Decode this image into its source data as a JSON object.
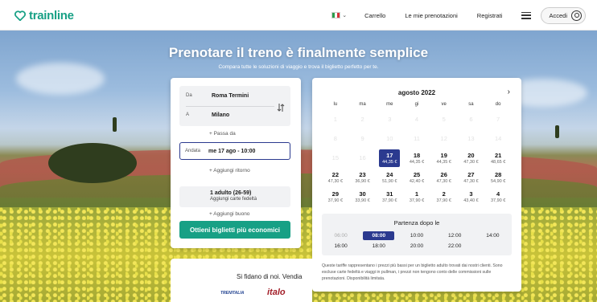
{
  "header": {
    "logo_text": "trainline",
    "flag_chevron": "⌄",
    "nav_items": [
      "Carrello",
      "Le mie prenotazioni",
      "Registrati"
    ],
    "login_label": "Accedi"
  },
  "hero": {
    "title": "Prenotare il treno è finalmente semplice",
    "subtitle": "Compara tutte le soluzioni di viaggio e trova il biglietto perfetto per te."
  },
  "search": {
    "from_label": "Da",
    "from_value": "Roma Termini",
    "to_label": "A",
    "to_value": "Milano",
    "via_link": "+ Passa da",
    "outbound_label": "Andata",
    "outbound_value": "me 17 ago - 10:00",
    "return_link": "+ Aggiungi ritorno",
    "passengers_value": "1 adulto (26-59)",
    "passengers_sub": "Aggiungi carte fedeltà",
    "voucher_link": "+ Aggiungi buono",
    "cta_label": "Ottieni biglietti più economici"
  },
  "calendar": {
    "month": "agosto 2022",
    "next_icon": "›",
    "weekdays": [
      "lu",
      "ma",
      "me",
      "gi",
      "ve",
      "sa",
      "do"
    ],
    "weeks": [
      [
        {
          "n": "1",
          "p": "",
          "past": true
        },
        {
          "n": "2",
          "p": "",
          "past": true
        },
        {
          "n": "3",
          "p": "",
          "past": true
        },
        {
          "n": "4",
          "p": "",
          "past": true
        },
        {
          "n": "5",
          "p": "",
          "past": true
        },
        {
          "n": "6",
          "p": "",
          "past": true
        },
        {
          "n": "7",
          "p": "",
          "past": true
        }
      ],
      [
        {
          "n": "8",
          "p": "",
          "past": true
        },
        {
          "n": "9",
          "p": "",
          "past": true
        },
        {
          "n": "10",
          "p": "",
          "past": true
        },
        {
          "n": "11",
          "p": "",
          "past": true
        },
        {
          "n": "12",
          "p": "",
          "past": true
        },
        {
          "n": "13",
          "p": "",
          "past": true
        },
        {
          "n": "14",
          "p": "",
          "past": true
        }
      ],
      [
        {
          "n": "15",
          "p": "",
          "past": true
        },
        {
          "n": "16",
          "p": "",
          "past": true
        },
        {
          "n": "17",
          "p": "44,35 €",
          "selected": true
        },
        {
          "n": "18",
          "p": "44,35 €"
        },
        {
          "n": "19",
          "p": "44,35 €"
        },
        {
          "n": "20",
          "p": "47,30 €"
        },
        {
          "n": "21",
          "p": "48,65 €"
        }
      ],
      [
        {
          "n": "22",
          "p": "47,30 €"
        },
        {
          "n": "23",
          "p": "36,90 €"
        },
        {
          "n": "24",
          "p": "51,90 €"
        },
        {
          "n": "25",
          "p": "42,40 €"
        },
        {
          "n": "26",
          "p": "47,30 €"
        },
        {
          "n": "27",
          "p": "47,30 €"
        },
        {
          "n": "28",
          "p": "54,90 €"
        }
      ],
      [
        {
          "n": "29",
          "p": "37,90 €"
        },
        {
          "n": "30",
          "p": "33,90 €"
        },
        {
          "n": "31",
          "p": "37,90 €"
        },
        {
          "n": "1",
          "p": "37,90 €"
        },
        {
          "n": "2",
          "p": "37,90 €"
        },
        {
          "n": "3",
          "p": "43,40 €"
        },
        {
          "n": "4",
          "p": "37,90 €"
        }
      ]
    ],
    "departure_title": "Partenza dopo le",
    "times_row1": [
      {
        "t": "06:00",
        "dim": true
      },
      {
        "t": "08:00",
        "selected": true
      },
      {
        "t": "10:00"
      },
      {
        "t": "12:00"
      },
      {
        "t": "14:00"
      }
    ],
    "times_row2": [
      {
        "t": "16:00"
      },
      {
        "t": "18:00"
      },
      {
        "t": "20:00"
      },
      {
        "t": "22:00"
      }
    ],
    "note": "Queste tariffe rappresentano i prezzi più bassi per un biglietto adulto trovati dai nostri clienti. Sono escluse carte fedeltà e viaggi in pullman, i prezzi non tengono conto delle commissioni sulle prenotazioni. Disponibilità limitata."
  },
  "trust": {
    "title": "Si fidano di noi. Vendia",
    "partners": [
      "TRENITALIA",
      "italo"
    ]
  },
  "colors": {
    "brand": "#17a085",
    "selected": "#2b3a8f"
  }
}
